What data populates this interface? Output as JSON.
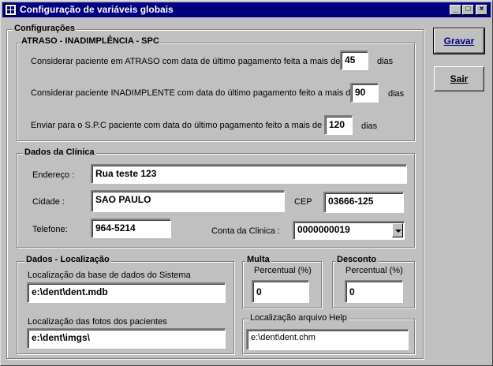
{
  "window": {
    "title": "Configuração de variáveis globais",
    "controls": {
      "minimize": "_",
      "maximize": "□",
      "close": "×"
    }
  },
  "configuracoes": {
    "legend": "Configurações"
  },
  "atraso": {
    "legend": "ATRASO - INADIMPLÊNCIA - SPC",
    "row1": {
      "label": "Considerar paciente em ATRASO com data de último pagamento feita a mais de",
      "value": "45",
      "unit": "dias"
    },
    "row2": {
      "label": "Considerar paciente INADIMPLENTE com data do último pagamento feito a mais de",
      "value": "90",
      "unit": "dias"
    },
    "row3": {
      "label": "Enviar para o S.P.C paciente com data do último pagamento feito a mais de",
      "value": "120",
      "unit": "dias"
    }
  },
  "clinica": {
    "legend": "Dados da Clínica",
    "endereco": {
      "label": "Endereço :",
      "value": "Rua teste 123"
    },
    "cidade": {
      "label": "Cidade :",
      "value": "SAO PAULO"
    },
    "cep": {
      "label": "CEP",
      "value": "03666-125"
    },
    "telefone": {
      "label": "Telefone:",
      "value": "964-5214"
    },
    "conta": {
      "label": "Conta da Clinica :",
      "value": "0000000019"
    }
  },
  "localizacao": {
    "legend": "Dados - Localização",
    "base": {
      "label": "Localização da base de dados do Sistema",
      "value": "e:\\dent\\dent.mdb"
    },
    "fotos": {
      "label": "Localização das fotos dos pacientes",
      "value": "e:\\dent\\imgs\\"
    }
  },
  "multa": {
    "legend": "Multa",
    "label": "Percentual (%)",
    "value": "0"
  },
  "desconto": {
    "legend": "Desconto",
    "label": "Percentual (%)",
    "value": "0"
  },
  "help": {
    "legend": "Localização arquivo Help",
    "value": "e:\\dent\\dent.chm"
  },
  "buttons": {
    "gravar": "Gravar",
    "sair": "Sair"
  }
}
